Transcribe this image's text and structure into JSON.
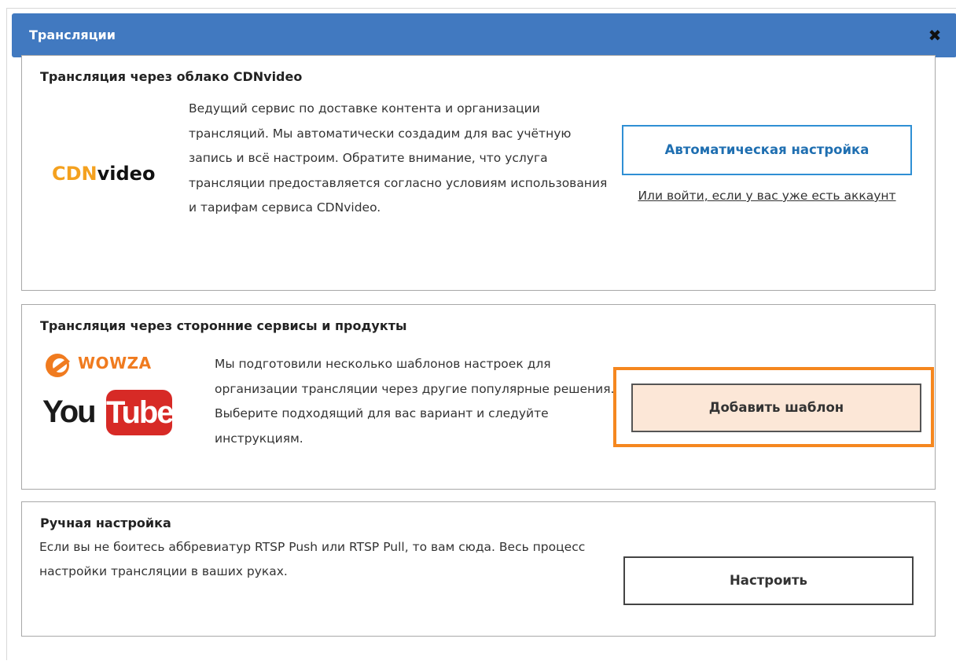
{
  "dialog": {
    "title": "Трансляции",
    "close_label": "✖",
    "header_color": "#4179c0"
  },
  "cdn_card": {
    "title": "Трансляция через облако CDNvideo",
    "logo": {
      "prefix": "CDN",
      "suffix": "video"
    },
    "description": "Ведущий сервис по доставке контента и организации трансляций. Мы автоматически создадим для вас учётную запись и всё настроим. Обратите внимание, что услуга трансляции предоставляется согласно условиям использования и тарифам сервиса CDNvideo.",
    "auto_button_label": "Автоматическая настройка",
    "login_link_label": "Или войти, если у вас уже есть аккаунт",
    "accent_color": "#2f8fd4"
  },
  "third_party_card": {
    "title": "Трансляция через сторонние сервисы и продукты",
    "wowza_label": "WOWZA",
    "youtube_you": "You",
    "youtube_tube": "Tube",
    "description": "Мы подготовили несколько шаблонов настроек для организации трансляции через другие популярные решения. Выберите подходящий для вас вариант и следуйте инструкциям.",
    "add_template_label": "Добавить шаблон",
    "highlight_color": "#f5871f"
  },
  "manual_card": {
    "title": "Ручная настройка",
    "description": "Если вы не боитесь аббревиатур RTSP Push или RTSP Pull, то вам сюда. Весь процесс настройки трансляции в ваших руках.",
    "setup_label": "Настроить"
  }
}
